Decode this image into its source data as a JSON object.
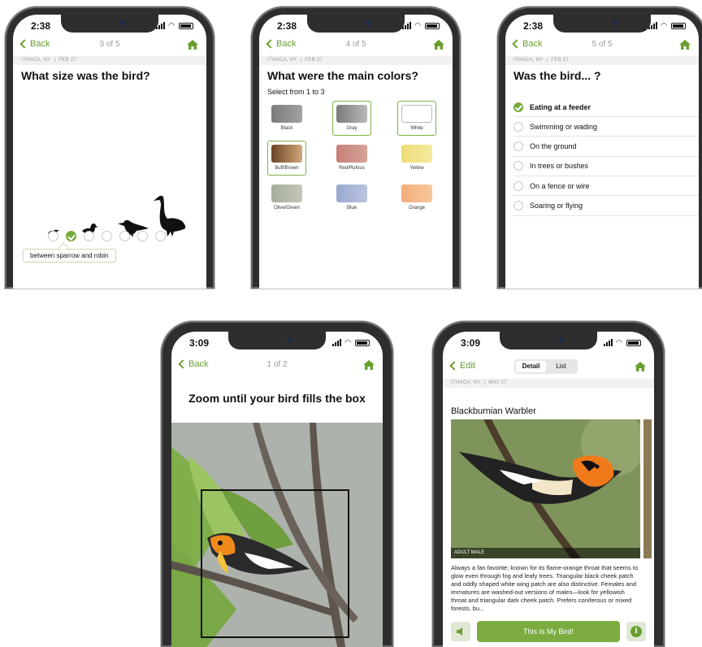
{
  "colors": {
    "accent": "#6a9e2f",
    "button": "#7cac3f",
    "meta_bg": "#f1f1f1"
  },
  "screens": {
    "size": {
      "time": "2:38",
      "back_label": "Back",
      "pager": "3 of 5",
      "location": "ITHACA, NY",
      "date": "FEB 27",
      "question": "What size was the bird?",
      "bird_sizes": [
        "sparrow",
        "robin",
        "crow",
        "goose"
      ],
      "size_options_count": 7,
      "selected_size_index": 1,
      "selected_label": "between sparrow and robin"
    },
    "colors": {
      "time": "2:38",
      "back_label": "Back",
      "pager": "4 of 5",
      "location": "ITHACA, NY",
      "date": "FEB 27",
      "question": "What were the main colors?",
      "instruction": "Select from 1 to 3",
      "swatches": [
        {
          "label": "Black",
          "color": "#8a8a8a",
          "selected": false
        },
        {
          "label": "Gray",
          "color": "#9a9a9a",
          "selected": true
        },
        {
          "label": "White",
          "color": "#ffffff",
          "selected": true
        },
        {
          "label": "Buff/Brown",
          "color": "#a07650",
          "selected": true
        },
        {
          "label": "Red/Rufous",
          "color": "#d08a82",
          "selected": false
        },
        {
          "label": "Yellow",
          "color": "#f1e28a",
          "selected": false
        },
        {
          "label": "Olive/Green",
          "color": "#b3baa7",
          "selected": false
        },
        {
          "label": "Blue",
          "color": "#a7b4d2",
          "selected": false
        },
        {
          "label": "Orange",
          "color": "#f3b68a",
          "selected": false
        }
      ]
    },
    "behavior": {
      "time": "2:38",
      "back_label": "Back",
      "pager": "5 of 5",
      "location": "ITHACA, NY",
      "date": "FEB 27",
      "question": "Was the bird... ?",
      "options": [
        {
          "label": "Eating at a feeder",
          "selected": true
        },
        {
          "label": "Swimming or wading",
          "selected": false
        },
        {
          "label": "On the ground",
          "selected": false
        },
        {
          "label": "In trees or bushes",
          "selected": false
        },
        {
          "label": "On a fence or wire",
          "selected": false
        },
        {
          "label": "Soaring or flying",
          "selected": false
        }
      ]
    },
    "zoom": {
      "time": "3:09",
      "back_label": "Back",
      "pager": "1 of 2",
      "title": "Zoom until your bird fills the box"
    },
    "detail": {
      "time": "3:09",
      "edit_label": "Edit",
      "tabs": [
        {
          "label": "Detail",
          "active": true
        },
        {
          "label": "List",
          "active": false
        }
      ],
      "location": "ITHACA, NY",
      "date": "MAY 27",
      "species": "Blackburnian Warbler",
      "photo_caption": "ADULT MALE",
      "description": "Always a fan favorite; known for its flame-orange throat that seems to glow even through fog and leafy trees. Triangular black cheek patch and oddly shaped white wing patch are also distinctive. Females and immatures are washed-out versions of males—look for yellowish throat and triangular dark cheek patch. Prefers coniferous or mixed forests, bu...",
      "confirm_label": "This Is My Bird!",
      "info_glyph": "i"
    }
  }
}
